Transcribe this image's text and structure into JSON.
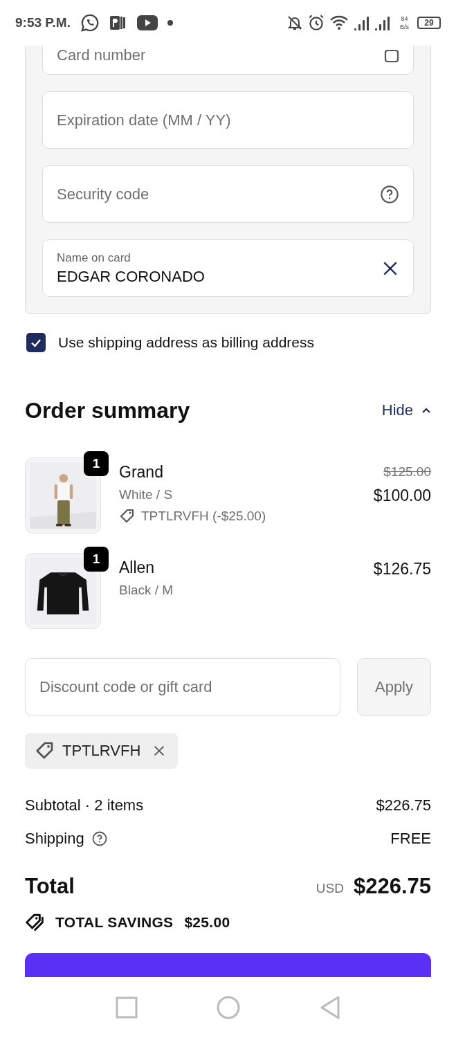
{
  "status_bar": {
    "time": "9:53 P.M.",
    "speed_value": "84",
    "speed_unit": "B/s",
    "battery": "29"
  },
  "payment": {
    "fields": [
      {
        "kind": "card",
        "placeholder": "Card number"
      },
      {
        "kind": "plain",
        "placeholder": "Expiration date (MM / YY)"
      },
      {
        "kind": "help",
        "placeholder": "Security code"
      },
      {
        "kind": "filled",
        "label": "Name on card",
        "value": "EDGAR CORONADO"
      }
    ]
  },
  "billing_checkbox": {
    "label": "Use shipping address as billing address",
    "checked": true
  },
  "order_summary": {
    "title": "Order summary",
    "toggle": "Hide",
    "expanded": true,
    "items": [
      {
        "name": "Grand",
        "variant": "White / S",
        "quantity": "1",
        "discount": "TPTLRVFH (-$25.00)",
        "original_price": "$125.00",
        "price": "$100.00"
      },
      {
        "name": "Allen",
        "variant": "Black / M",
        "quantity": "1",
        "price": "$126.75"
      }
    ],
    "discount_field": {
      "placeholder": "Discount code or gift card",
      "button": "Apply"
    },
    "applied_codes": [
      {
        "code": "TPTLRVFH"
      }
    ],
    "lines": [
      {
        "label": "Subtotal · 2 items",
        "value": "$226.75"
      },
      {
        "label": "Shipping",
        "value": "FREE",
        "help": true
      }
    ],
    "total": {
      "label": "Total",
      "currency": "USD",
      "amount": "$226.75"
    },
    "savings": {
      "label": "TOTAL SAVINGS",
      "amount": "$25.00"
    }
  }
}
